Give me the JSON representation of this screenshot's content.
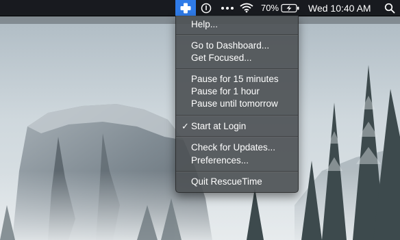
{
  "menubar": {
    "app_icon": "rescuetime-cross-icon",
    "status_icons": [
      "clock-circle-icon",
      "more-dots-icon",
      "wifi-icon",
      "battery-charging-icon",
      "spotlight-search-icon"
    ],
    "battery_percent": "70%",
    "clock": "Wed 10:40 AM",
    "accent_color": "#2f7be8"
  },
  "menu": {
    "help": "Help...",
    "go_to_dashboard": "Go to Dashboard...",
    "get_focused": "Get Focused...",
    "pause_15": "Pause for 15 minutes",
    "pause_1h": "Pause for 1 hour",
    "pause_tomorrow": "Pause until tomorrow",
    "start_at_login": "Start at Login",
    "start_at_login_checkmark": "✓",
    "check_updates": "Check for Updates...",
    "preferences": "Preferences...",
    "quit": "Quit RescueTime"
  }
}
